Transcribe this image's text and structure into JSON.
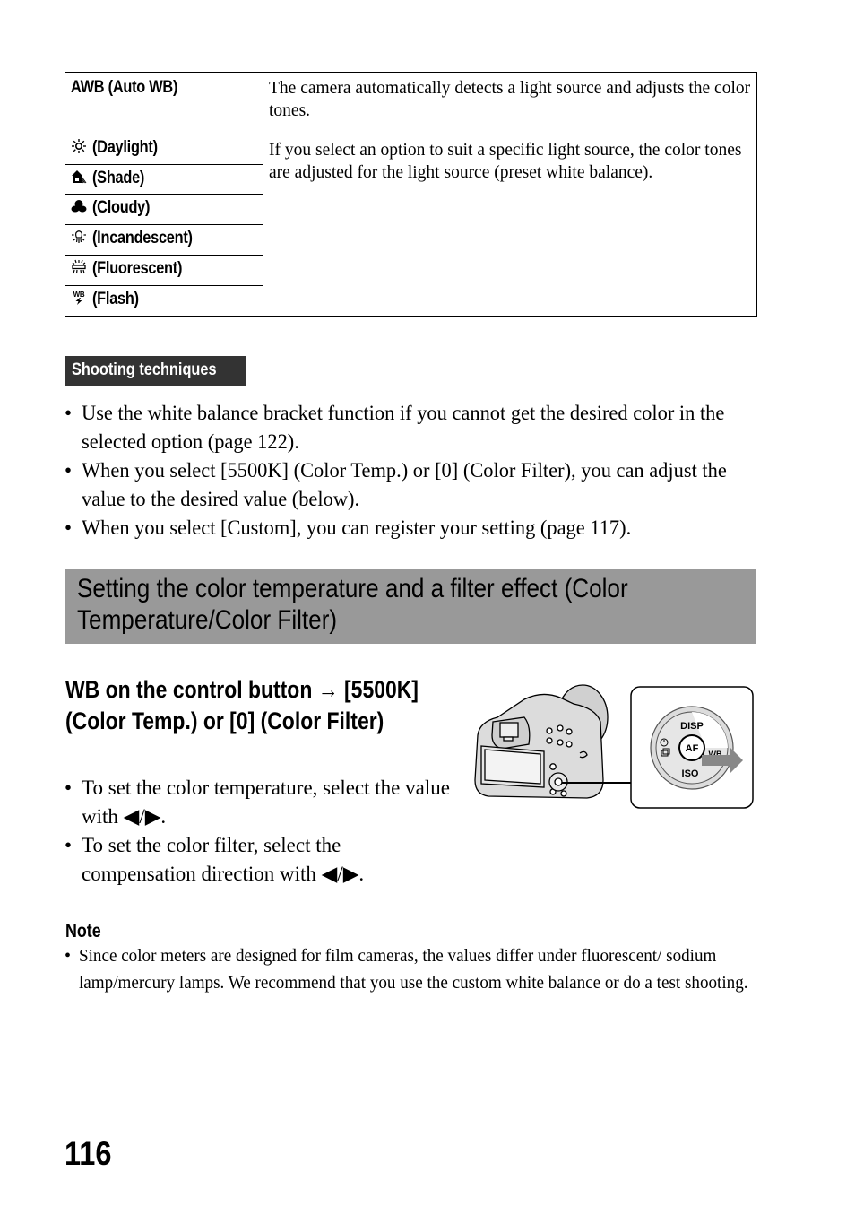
{
  "wb_table": {
    "rows": [
      {
        "icon": "awb",
        "label": "AWB (Auto WB)",
        "description": "The camera automatically detects a light source and adjusts the color tones."
      },
      {
        "icon": "daylight-icon",
        "label": "(Daylight)"
      },
      {
        "icon": "shade-icon",
        "label": "(Shade)"
      },
      {
        "icon": "cloudy-icon",
        "label": "(Cloudy)"
      },
      {
        "icon": "incandescent-icon",
        "label": "(Incandescent)"
      },
      {
        "icon": "fluorescent-icon",
        "label": "(Fluorescent)"
      },
      {
        "icon": "flash-icon",
        "label": "(Flash)"
      }
    ],
    "preset_description": "If you select an option to suit a specific light source, the color tones are adjusted for the light source (preset white balance)."
  },
  "shooting_techniques": {
    "tag": "Shooting techniques",
    "bullets": [
      "Use the white balance bracket function if you cannot get the desired color in the selected option (page 122).",
      "When you select [5500K] (Color Temp.) or [0] (Color Filter), you can adjust the value to the desired value (below).",
      "When you select [Custom], you can register your setting (page 117)."
    ]
  },
  "section": {
    "title": "Setting the color temperature and a filter effect (Color Temperature/Color Filter)"
  },
  "procedure": {
    "heading": "WB on the control button → [5500K] (Color Temp.) or [0] (Color Filter)",
    "bullets": [
      "To set the color temperature, select the value with ◀/▶.",
      "To set the color filter, select the compensation direction with ◀/▶."
    ]
  },
  "illustration": {
    "dial_labels": {
      "top": "DISP",
      "center": "AF",
      "right": "WB",
      "bottom": "ISO"
    }
  },
  "note": {
    "title": "Note",
    "bullets": [
      "Since color meters are designed for film cameras, the values differ under fluorescent/ sodium lamp/mercury lamps. We recommend that you use the custom white balance or do a test shooting."
    ]
  },
  "bullet_char": "•",
  "page_number": "116"
}
